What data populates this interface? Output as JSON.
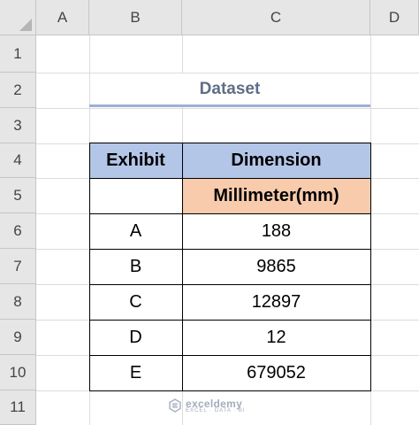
{
  "columns": [
    "A",
    "B",
    "C",
    "D"
  ],
  "rows": [
    "1",
    "2",
    "3",
    "4",
    "5",
    "6",
    "7",
    "8",
    "9",
    "10",
    "11"
  ],
  "title": "Dataset",
  "table": {
    "header1": "Exhibit",
    "header2": "Dimension",
    "subheader": "Millimeter(mm)",
    "data": [
      {
        "exhibit": "A",
        "value": "188"
      },
      {
        "exhibit": "B",
        "value": "9865"
      },
      {
        "exhibit": "C",
        "value": "12897"
      },
      {
        "exhibit": "D",
        "value": "12"
      },
      {
        "exhibit": "E",
        "value": "679052"
      }
    ]
  },
  "watermark": {
    "name": "exceldemy",
    "tagline": "EXCEL · DATA · BI",
    "icon": "exceldemy-logo-icon"
  },
  "colors": {
    "header_blue": "#b4c6e7",
    "header_orange": "#f8cbad",
    "title_text": "#5f6e87",
    "title_underline": "#9db0d3"
  }
}
